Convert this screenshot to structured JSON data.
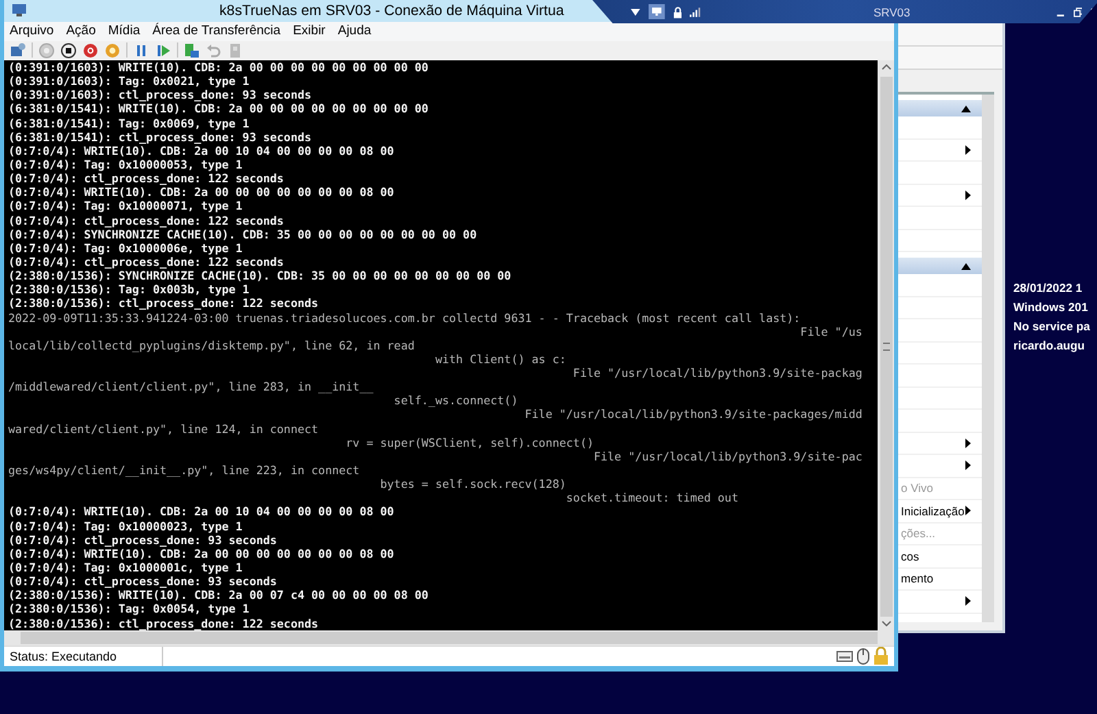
{
  "vm_window": {
    "title": "k8sTrueNas em SRV03 - Conexão de Máquina Virtua",
    "menu": [
      "Arquivo",
      "Ação",
      "Mídia",
      "Área de Transferência",
      "Exibir",
      "Ajuda"
    ],
    "console_lines": [
      {
        "kind": "kernel",
        "text": "(0:391:0/1603): WRITE(10). CDB: 2a 00 00 00 00 00 00 00 00 00"
      },
      {
        "kind": "kernel",
        "text": "(0:391:0/1603): Tag: 0x0021, type 1"
      },
      {
        "kind": "kernel",
        "text": "(0:391:0/1603): ctl_process_done: 93 seconds"
      },
      {
        "kind": "kernel",
        "text": "(6:381:0/1541): WRITE(10). CDB: 2a 00 00 00 00 00 00 00 00 00"
      },
      {
        "kind": "kernel",
        "text": "(6:381:0/1541): Tag: 0x0069, type 1"
      },
      {
        "kind": "kernel",
        "text": "(6:381:0/1541): ctl_process_done: 93 seconds"
      },
      {
        "kind": "kernel",
        "text": "(0:7:0/4): WRITE(10). CDB: 2a 00 10 04 00 00 00 00 08 00"
      },
      {
        "kind": "kernel",
        "text": "(0:7:0/4): Tag: 0x10000053, type 1"
      },
      {
        "kind": "kernel",
        "text": "(0:7:0/4): ctl_process_done: 122 seconds"
      },
      {
        "kind": "kernel",
        "text": "(0:7:0/4): WRITE(10). CDB: 2a 00 00 00 00 00 00 00 08 00"
      },
      {
        "kind": "kernel",
        "text": "(0:7:0/4): Tag: 0x10000071, type 1"
      },
      {
        "kind": "kernel",
        "text": "(0:7:0/4): ctl_process_done: 122 seconds"
      },
      {
        "kind": "kernel",
        "text": "(0:7:0/4): SYNCHRONIZE CACHE(10). CDB: 35 00 00 00 00 00 00 00 00 00"
      },
      {
        "kind": "kernel",
        "text": "(0:7:0/4): Tag: 0x1000006e, type 1"
      },
      {
        "kind": "kernel",
        "text": "(0:7:0/4): ctl_process_done: 122 seconds"
      },
      {
        "kind": "kernel",
        "text": "(2:380:0/1536): SYNCHRONIZE CACHE(10). CDB: 35 00 00 00 00 00 00 00 00 00"
      },
      {
        "kind": "kernel",
        "text": "(2:380:0/1536): Tag: 0x003b, type 1"
      },
      {
        "kind": "kernel",
        "text": "(2:380:0/1536): ctl_process_done: 122 seconds"
      },
      {
        "kind": "log",
        "text": "2022-09-09T11:35:33.941224-03:00 truenas.triadesolucoes.com.br collectd 9631 - - Traceback (most recent call last):"
      },
      {
        "kind": "log",
        "text": "                                                                                                                   File \"/us"
      },
      {
        "kind": "log",
        "text": "local/lib/collectd_pyplugins/disktemp.py\", line 62, in read"
      },
      {
        "kind": "log",
        "text": "                                                              with Client() as c:"
      },
      {
        "kind": "log",
        "text": "                                                                                  File \"/usr/local/lib/python3.9/site-packag"
      },
      {
        "kind": "log",
        "text": "/middlewared/client/client.py\", line 283, in __init__"
      },
      {
        "kind": "log",
        "text": "                                                        self._ws.connect()"
      },
      {
        "kind": "log",
        "text": "                                                                           File \"/usr/local/lib/python3.9/site-packages/midd"
      },
      {
        "kind": "log",
        "text": "wared/client/client.py\", line 124, in connect"
      },
      {
        "kind": "log",
        "text": "                                                 rv = super(WSClient, self).connect()"
      },
      {
        "kind": "log",
        "text": "                                                                                     File \"/usr/local/lib/python3.9/site-pac"
      },
      {
        "kind": "log",
        "text": "ges/ws4py/client/__init__.py\", line 223, in connect"
      },
      {
        "kind": "log",
        "text": "                                                      bytes = self.sock.recv(128)"
      },
      {
        "kind": "log",
        "text": "                                                                                 socket.timeout: timed out"
      },
      {
        "kind": "kernel",
        "text": "(0:7:0/4): WRITE(10). CDB: 2a 00 10 04 00 00 00 00 08 00"
      },
      {
        "kind": "kernel",
        "text": "(0:7:0/4): Tag: 0x10000023, type 1"
      },
      {
        "kind": "kernel",
        "text": "(0:7:0/4): ctl_process_done: 93 seconds"
      },
      {
        "kind": "kernel",
        "text": "(0:7:0/4): WRITE(10). CDB: 2a 00 00 00 00 00 00 00 08 00"
      },
      {
        "kind": "kernel",
        "text": "(0:7:0/4): Tag: 0x1000001c, type 1"
      },
      {
        "kind": "kernel",
        "text": "(0:7:0/4): ctl_process_done: 93 seconds"
      },
      {
        "kind": "kernel",
        "text": "(2:380:0/1536): WRITE(10). CDB: 2a 00 07 c4 00 00 00 00 08 00"
      },
      {
        "kind": "kernel",
        "text": "(2:380:0/1536): Tag: 0x0054, type 1"
      },
      {
        "kind": "kernel",
        "text": "(2:380:0/1536): ctl_process_done: 122 seconds"
      }
    ],
    "status": "Status: Executando"
  },
  "connection_bar": {
    "host": "SRV03"
  },
  "background_window": {
    "sections": [
      {
        "items": [
          {
            "submenu": false
          },
          {
            "submenu": true
          },
          {
            "submenu": false
          },
          {
            "submenu": true
          },
          {
            "submenu": false
          },
          {
            "submenu": false
          }
        ]
      },
      {
        "items": [
          {
            "submenu": false
          },
          {
            "submenu": false
          },
          {
            "submenu": false
          },
          {
            "submenu": false
          },
          {
            "submenu": false
          },
          {
            "submenu": false
          },
          {
            "submenu": false
          },
          {
            "submenu": true
          },
          {
            "submenu": true
          },
          {
            "label": "o Vivo",
            "disabled": true,
            "submenu": false
          },
          {
            "label": "Inicialização",
            "disabled": false,
            "submenu": true
          },
          {
            "label": "ções...",
            "disabled": true,
            "submenu": false
          },
          {
            "label": "cos",
            "disabled": false,
            "submenu": false
          },
          {
            "label": "mento",
            "disabled": false,
            "submenu": false
          },
          {
            "submenu": true
          }
        ]
      }
    ]
  },
  "desktop_info": [
    "28/01/2022 1",
    "Windows 201",
    "No service pa",
    "ricardo.augu"
  ]
}
